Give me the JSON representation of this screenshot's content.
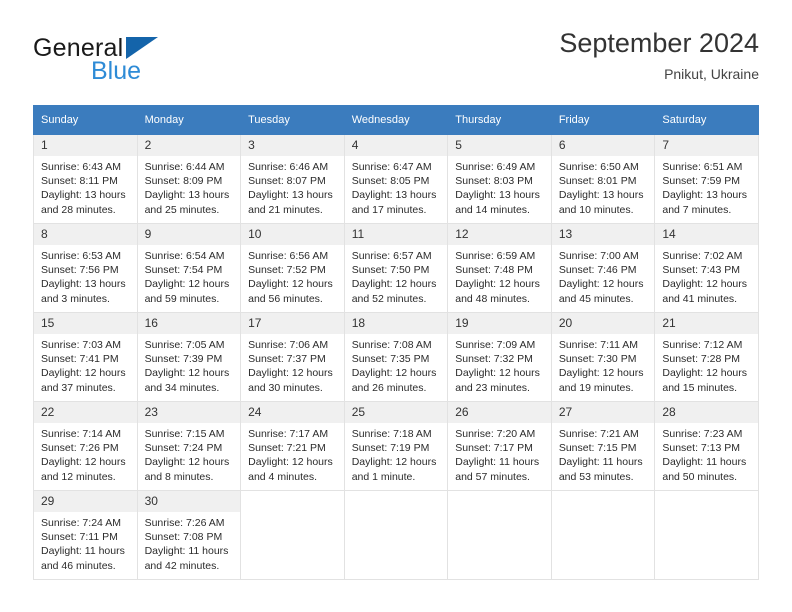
{
  "brand": {
    "name_top": "General",
    "name_bottom": "Blue",
    "triangle_color": "#1464aa",
    "blue_color": "#2e8bd6"
  },
  "header": {
    "title": "September 2024",
    "location": "Pnikut, Ukraine"
  },
  "theme": {
    "header_row_bg": "#3b7cbe",
    "header_row_text": "#ffffff",
    "daynum_bg": "#f0f0f0",
    "cell_border": "#e2e2e2"
  },
  "weekdays": [
    "Sunday",
    "Monday",
    "Tuesday",
    "Wednesday",
    "Thursday",
    "Friday",
    "Saturday"
  ],
  "weeks": [
    [
      {
        "day": "1",
        "sunrise": "Sunrise: 6:43 AM",
        "sunset": "Sunset: 8:11 PM",
        "daylight1": "Daylight: 13 hours",
        "daylight2": "and 28 minutes."
      },
      {
        "day": "2",
        "sunrise": "Sunrise: 6:44 AM",
        "sunset": "Sunset: 8:09 PM",
        "daylight1": "Daylight: 13 hours",
        "daylight2": "and 25 minutes."
      },
      {
        "day": "3",
        "sunrise": "Sunrise: 6:46 AM",
        "sunset": "Sunset: 8:07 PM",
        "daylight1": "Daylight: 13 hours",
        "daylight2": "and 21 minutes."
      },
      {
        "day": "4",
        "sunrise": "Sunrise: 6:47 AM",
        "sunset": "Sunset: 8:05 PM",
        "daylight1": "Daylight: 13 hours",
        "daylight2": "and 17 minutes."
      },
      {
        "day": "5",
        "sunrise": "Sunrise: 6:49 AM",
        "sunset": "Sunset: 8:03 PM",
        "daylight1": "Daylight: 13 hours",
        "daylight2": "and 14 minutes."
      },
      {
        "day": "6",
        "sunrise": "Sunrise: 6:50 AM",
        "sunset": "Sunset: 8:01 PM",
        "daylight1": "Daylight: 13 hours",
        "daylight2": "and 10 minutes."
      },
      {
        "day": "7",
        "sunrise": "Sunrise: 6:51 AM",
        "sunset": "Sunset: 7:59 PM",
        "daylight1": "Daylight: 13 hours",
        "daylight2": "and 7 minutes."
      }
    ],
    [
      {
        "day": "8",
        "sunrise": "Sunrise: 6:53 AM",
        "sunset": "Sunset: 7:56 PM",
        "daylight1": "Daylight: 13 hours",
        "daylight2": "and 3 minutes."
      },
      {
        "day": "9",
        "sunrise": "Sunrise: 6:54 AM",
        "sunset": "Sunset: 7:54 PM",
        "daylight1": "Daylight: 12 hours",
        "daylight2": "and 59 minutes."
      },
      {
        "day": "10",
        "sunrise": "Sunrise: 6:56 AM",
        "sunset": "Sunset: 7:52 PM",
        "daylight1": "Daylight: 12 hours",
        "daylight2": "and 56 minutes."
      },
      {
        "day": "11",
        "sunrise": "Sunrise: 6:57 AM",
        "sunset": "Sunset: 7:50 PM",
        "daylight1": "Daylight: 12 hours",
        "daylight2": "and 52 minutes."
      },
      {
        "day": "12",
        "sunrise": "Sunrise: 6:59 AM",
        "sunset": "Sunset: 7:48 PM",
        "daylight1": "Daylight: 12 hours",
        "daylight2": "and 48 minutes."
      },
      {
        "day": "13",
        "sunrise": "Sunrise: 7:00 AM",
        "sunset": "Sunset: 7:46 PM",
        "daylight1": "Daylight: 12 hours",
        "daylight2": "and 45 minutes."
      },
      {
        "day": "14",
        "sunrise": "Sunrise: 7:02 AM",
        "sunset": "Sunset: 7:43 PM",
        "daylight1": "Daylight: 12 hours",
        "daylight2": "and 41 minutes."
      }
    ],
    [
      {
        "day": "15",
        "sunrise": "Sunrise: 7:03 AM",
        "sunset": "Sunset: 7:41 PM",
        "daylight1": "Daylight: 12 hours",
        "daylight2": "and 37 minutes."
      },
      {
        "day": "16",
        "sunrise": "Sunrise: 7:05 AM",
        "sunset": "Sunset: 7:39 PM",
        "daylight1": "Daylight: 12 hours",
        "daylight2": "and 34 minutes."
      },
      {
        "day": "17",
        "sunrise": "Sunrise: 7:06 AM",
        "sunset": "Sunset: 7:37 PM",
        "daylight1": "Daylight: 12 hours",
        "daylight2": "and 30 minutes."
      },
      {
        "day": "18",
        "sunrise": "Sunrise: 7:08 AM",
        "sunset": "Sunset: 7:35 PM",
        "daylight1": "Daylight: 12 hours",
        "daylight2": "and 26 minutes."
      },
      {
        "day": "19",
        "sunrise": "Sunrise: 7:09 AM",
        "sunset": "Sunset: 7:32 PM",
        "daylight1": "Daylight: 12 hours",
        "daylight2": "and 23 minutes."
      },
      {
        "day": "20",
        "sunrise": "Sunrise: 7:11 AM",
        "sunset": "Sunset: 7:30 PM",
        "daylight1": "Daylight: 12 hours",
        "daylight2": "and 19 minutes."
      },
      {
        "day": "21",
        "sunrise": "Sunrise: 7:12 AM",
        "sunset": "Sunset: 7:28 PM",
        "daylight1": "Daylight: 12 hours",
        "daylight2": "and 15 minutes."
      }
    ],
    [
      {
        "day": "22",
        "sunrise": "Sunrise: 7:14 AM",
        "sunset": "Sunset: 7:26 PM",
        "daylight1": "Daylight: 12 hours",
        "daylight2": "and 12 minutes."
      },
      {
        "day": "23",
        "sunrise": "Sunrise: 7:15 AM",
        "sunset": "Sunset: 7:24 PM",
        "daylight1": "Daylight: 12 hours",
        "daylight2": "and 8 minutes."
      },
      {
        "day": "24",
        "sunrise": "Sunrise: 7:17 AM",
        "sunset": "Sunset: 7:21 PM",
        "daylight1": "Daylight: 12 hours",
        "daylight2": "and 4 minutes."
      },
      {
        "day": "25",
        "sunrise": "Sunrise: 7:18 AM",
        "sunset": "Sunset: 7:19 PM",
        "daylight1": "Daylight: 12 hours",
        "daylight2": "and 1 minute."
      },
      {
        "day": "26",
        "sunrise": "Sunrise: 7:20 AM",
        "sunset": "Sunset: 7:17 PM",
        "daylight1": "Daylight: 11 hours",
        "daylight2": "and 57 minutes."
      },
      {
        "day": "27",
        "sunrise": "Sunrise: 7:21 AM",
        "sunset": "Sunset: 7:15 PM",
        "daylight1": "Daylight: 11 hours",
        "daylight2": "and 53 minutes."
      },
      {
        "day": "28",
        "sunrise": "Sunrise: 7:23 AM",
        "sunset": "Sunset: 7:13 PM",
        "daylight1": "Daylight: 11 hours",
        "daylight2": "and 50 minutes."
      }
    ],
    [
      {
        "day": "29",
        "sunrise": "Sunrise: 7:24 AM",
        "sunset": "Sunset: 7:11 PM",
        "daylight1": "Daylight: 11 hours",
        "daylight2": "and 46 minutes."
      },
      {
        "day": "30",
        "sunrise": "Sunrise: 7:26 AM",
        "sunset": "Sunset: 7:08 PM",
        "daylight1": "Daylight: 11 hours",
        "daylight2": "and 42 minutes."
      },
      {
        "day": "",
        "sunrise": "",
        "sunset": "",
        "daylight1": "",
        "daylight2": ""
      },
      {
        "day": "",
        "sunrise": "",
        "sunset": "",
        "daylight1": "",
        "daylight2": ""
      },
      {
        "day": "",
        "sunrise": "",
        "sunset": "",
        "daylight1": "",
        "daylight2": ""
      },
      {
        "day": "",
        "sunrise": "",
        "sunset": "",
        "daylight1": "",
        "daylight2": ""
      },
      {
        "day": "",
        "sunrise": "",
        "sunset": "",
        "daylight1": "",
        "daylight2": ""
      }
    ]
  ]
}
